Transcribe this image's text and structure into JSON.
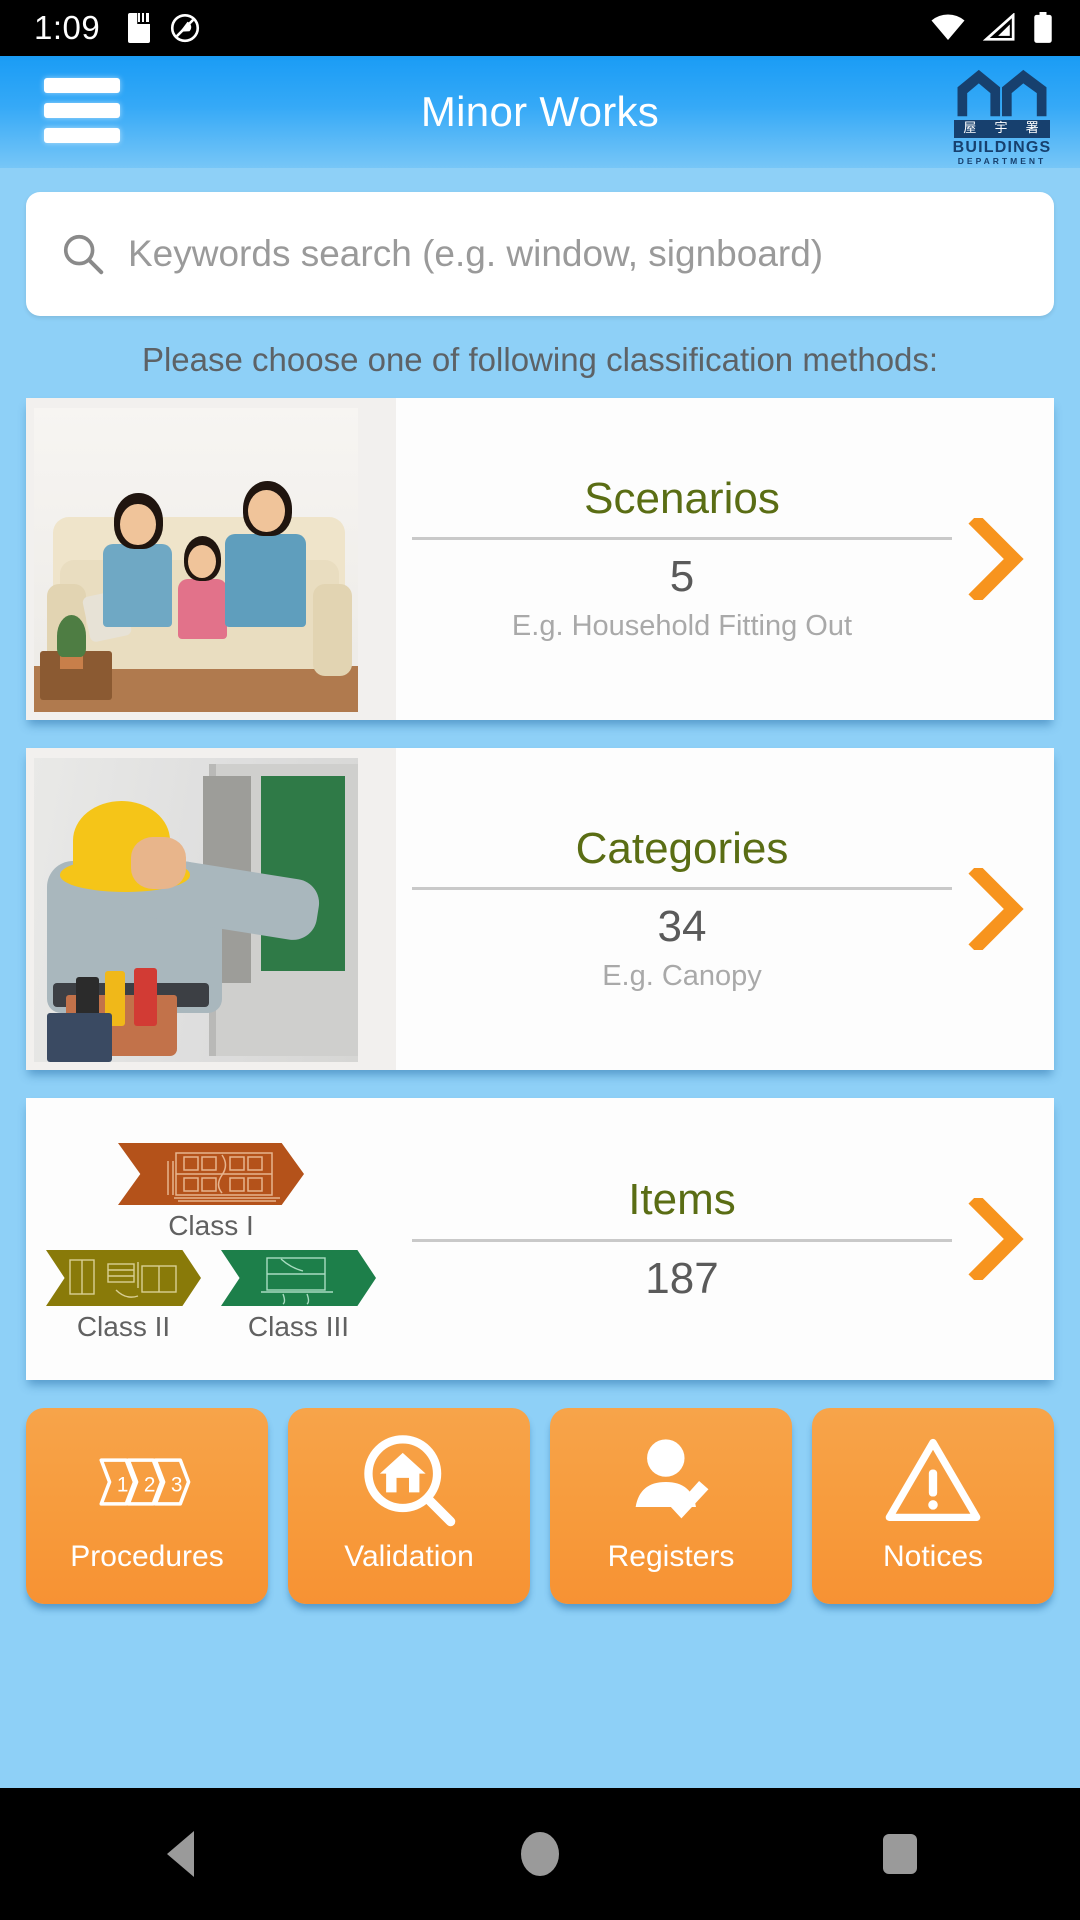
{
  "statusbar": {
    "time": "1:09",
    "icons": [
      "sdcard-icon",
      "do-not-disturb-icon",
      "wifi-icon",
      "cellular-signal-icon",
      "battery-icon"
    ]
  },
  "appbar": {
    "menu_icon": "hamburger-menu-icon",
    "title": "Minor Works",
    "logo": {
      "chinese": "屋 宇 署",
      "line1": "BUILDINGS",
      "line2": "DEPARTMENT"
    }
  },
  "search": {
    "icon": "search-icon",
    "placeholder": "Keywords search (e.g. window, signboard)",
    "value": ""
  },
  "instruction": "Please choose one of following classification methods:",
  "cards": [
    {
      "name": "scenarios",
      "title": "Scenarios",
      "count": "5",
      "example": "E.g. Household Fitting Out",
      "thumb": "family-on-sofa-photo",
      "arrow": "chevron-right-icon"
    },
    {
      "name": "categories",
      "title": "Categories",
      "count": "34",
      "example": "E.g. Canopy",
      "thumb": "worker-installing-window-photo",
      "arrow": "chevron-right-icon"
    },
    {
      "name": "items",
      "title": "Items",
      "count": "187",
      "example": "",
      "thumb": "class-chevron-badges",
      "arrow": "chevron-right-icon"
    }
  ],
  "classes": [
    {
      "label": "Class I",
      "color": "#b4521a"
    },
    {
      "label": "Class II",
      "color": "#897a09"
    },
    {
      "label": "Class III",
      "color": "#1d7f4a"
    }
  ],
  "actions": [
    {
      "label": "Procedures",
      "icon": "numbered-chevrons-123-icon"
    },
    {
      "label": "Validation",
      "icon": "house-magnifier-icon"
    },
    {
      "label": "Registers",
      "icon": "person-check-icon"
    },
    {
      "label": "Notices",
      "icon": "warning-triangle-icon"
    }
  ],
  "navbar": {
    "back": "back-triangle-icon",
    "home": "home-circle-icon",
    "recents": "recents-square-icon"
  },
  "colors": {
    "accent_blue": "#35a9f7",
    "page_blue": "#8ed0f7",
    "title_green": "#5a6d14",
    "orange": "#f79b3c",
    "arrow_orange": "#f7941e"
  }
}
